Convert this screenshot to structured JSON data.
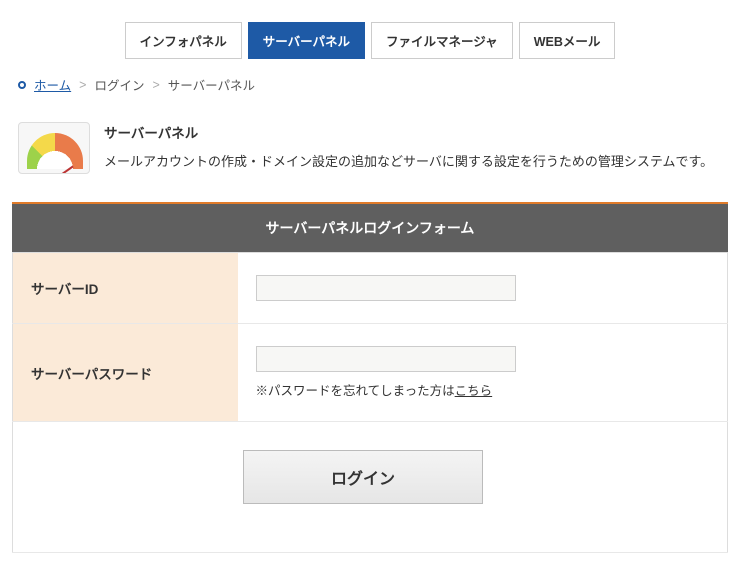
{
  "tabs": {
    "info": "インフォパネル",
    "server": "サーバーパネル",
    "file": "ファイルマネージャ",
    "webmail": "WEBメール"
  },
  "breadcrumb": {
    "home": "ホーム",
    "login": "ログイン",
    "current": "サーバーパネル"
  },
  "intro": {
    "title": "サーバーパネル",
    "desc": "メールアカウントの作成・ドメイン設定の追加などサーバに関する設定を行うための管理システムです。"
  },
  "form": {
    "header": "サーバーパネルログインフォーム",
    "id_label": "サーバーID",
    "password_label": "サーバーパスワード",
    "forgot_prefix": "※パスワードを忘れてしまった方は",
    "forgot_link": "こちら",
    "submit": "ログイン"
  }
}
